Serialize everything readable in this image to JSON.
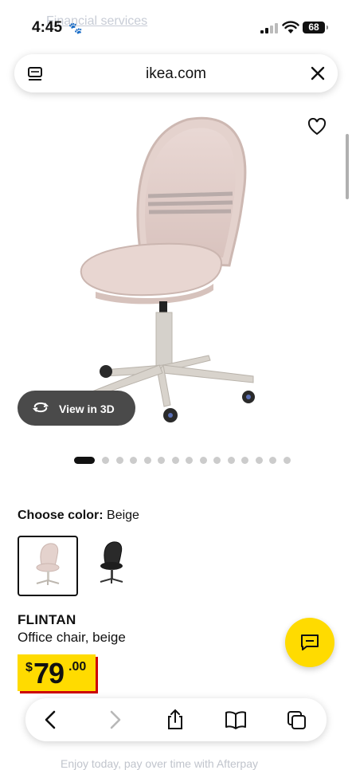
{
  "status_bar": {
    "time": "4:45",
    "battery": "68",
    "behind_text": "Financial services"
  },
  "browser": {
    "url": "ikea.com",
    "back_enabled": true,
    "forward_enabled": false
  },
  "product": {
    "view_3d_label": "View in 3D",
    "carousel": {
      "total": 15,
      "active": 0
    },
    "choose_color_label": "Choose color:",
    "selected_color": "Beige",
    "swatches": [
      "beige",
      "black"
    ],
    "name": "FLINTAN",
    "description": "Office chair, beige",
    "price": {
      "currency": "$",
      "integer": "79",
      "decimal": ".00"
    }
  },
  "footer_peek_text": "Enjoy today, pay over time with Afterpay",
  "colors": {
    "ikea_yellow": "#ffdb00",
    "price_shadow": "#cc0008",
    "button_dark": "#4a4a4a"
  }
}
